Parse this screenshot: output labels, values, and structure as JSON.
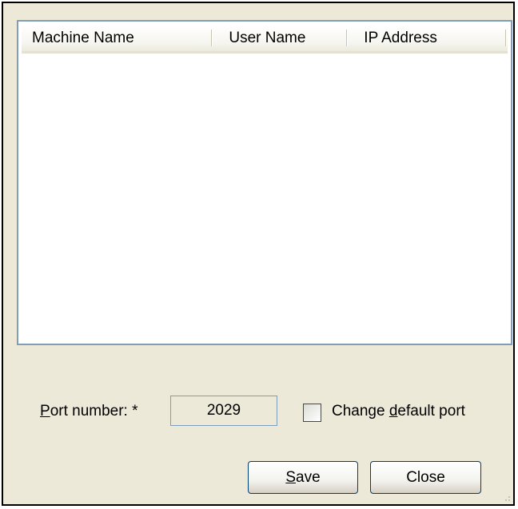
{
  "listview": {
    "columns": [
      "Machine Name",
      "User Name",
      "IP Address"
    ],
    "rows": []
  },
  "port": {
    "label_mnemonic": "P",
    "label_rest": "ort number: *",
    "value": "2029"
  },
  "change_default_port": {
    "checked": false,
    "label_before": "Change ",
    "label_mnemonic": "d",
    "label_after": "efault port"
  },
  "buttons": {
    "save_mnemonic": "S",
    "save_rest": "ave",
    "close_label": "Close"
  },
  "icons": {
    "checkbox": "checkbox-unchecked-icon",
    "grip": "resize-grip-icon"
  }
}
